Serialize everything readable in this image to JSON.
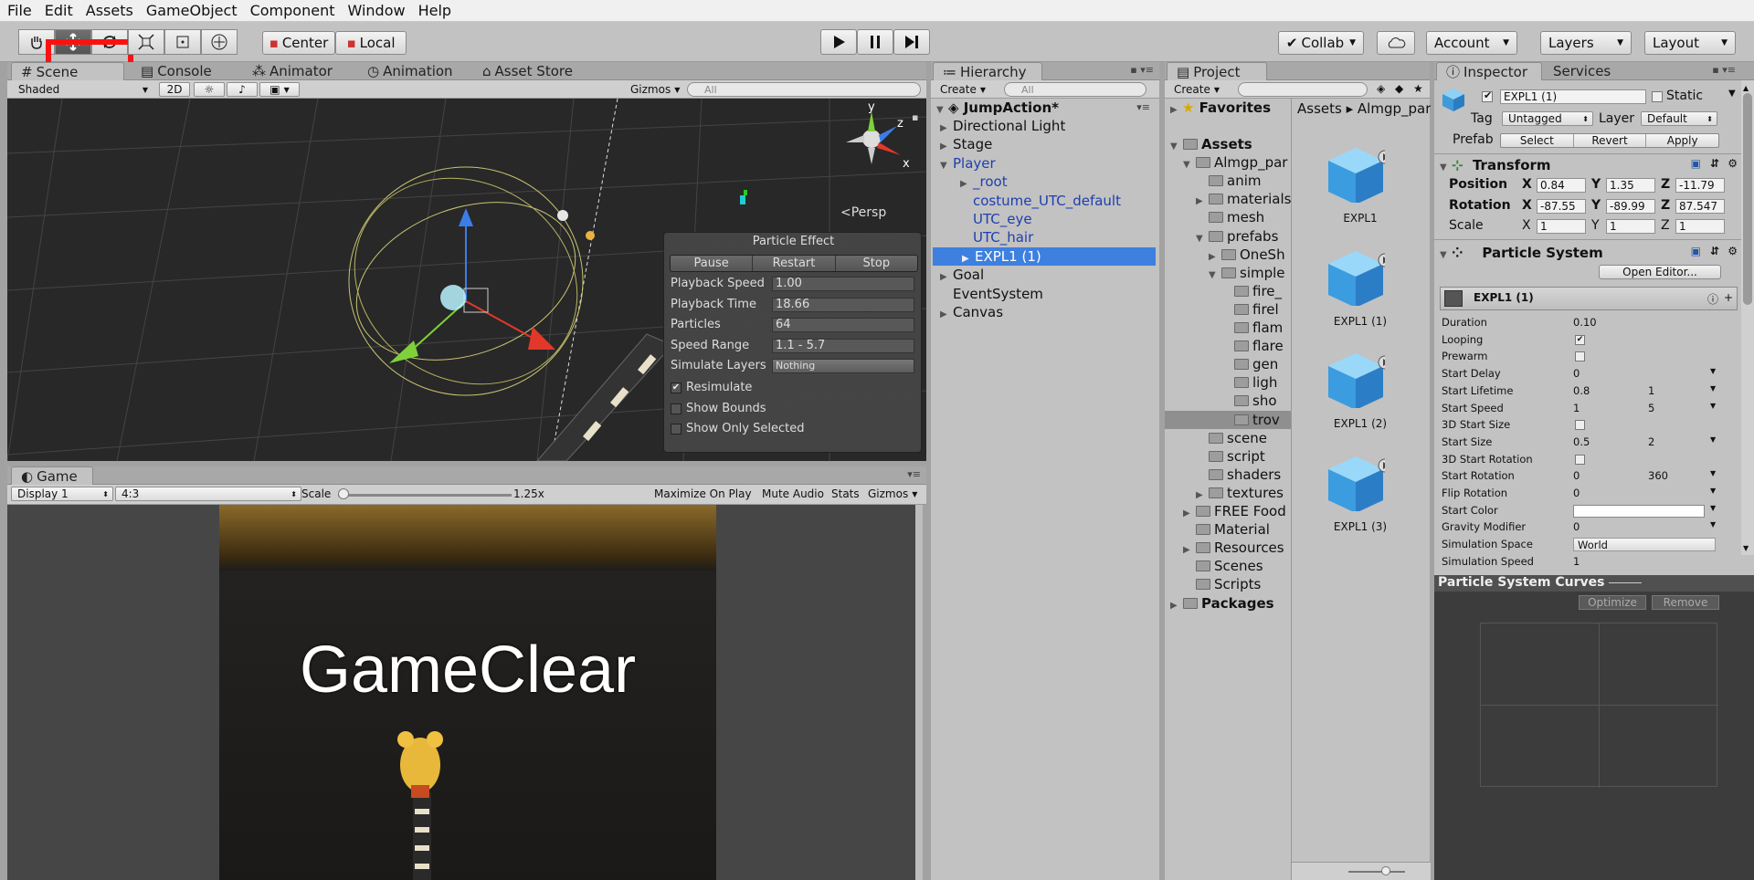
{
  "menu": [
    "File",
    "Edit",
    "Assets",
    "GameObject",
    "Component",
    "Window",
    "Help"
  ],
  "toolbar": {
    "center_label": "Center",
    "local_label": "Local",
    "collab_label": "Collab",
    "account_label": "Account",
    "layers_label": "Layers",
    "layout_label": "Layout"
  },
  "scene": {
    "tabs": [
      "Scene",
      "Console",
      "Animator",
      "Animation",
      "Asset Store"
    ],
    "shading": "Shaded",
    "mode_2d": "2D",
    "gizmos": "Gizmos",
    "search_placeholder": "All",
    "persp": "Persp",
    "gizmo_axes": {
      "y": "y",
      "z": "z",
      "x": "x"
    }
  },
  "particle_effect": {
    "title": "Particle Effect",
    "pause": "Pause",
    "restart": "Restart",
    "stop": "Stop",
    "rows": [
      {
        "label": "Playback Speed",
        "value": "1.00"
      },
      {
        "label": "Playback Time",
        "value": "18.66"
      },
      {
        "label": "Particles",
        "value": "64"
      },
      {
        "label": "Speed Range",
        "value": "1.1 - 5.7"
      },
      {
        "label": "Simulate Layers",
        "value": "Nothing"
      }
    ],
    "checks": [
      {
        "label": "Resimulate",
        "checked": true
      },
      {
        "label": "Show Bounds",
        "checked": false
      },
      {
        "label": "Show Only Selected",
        "checked": false
      }
    ]
  },
  "game": {
    "tab": "Game",
    "display": "Display 1",
    "aspect": "4:3",
    "scale_label": "Scale",
    "scale_value": "1.25x",
    "maximize": "Maximize On Play",
    "mute": "Mute Audio",
    "stats": "Stats",
    "gizmos": "Gizmos",
    "overlay_text": "GameClear"
  },
  "hierarchy": {
    "tab": "Hierarchy",
    "create": "Create",
    "search_placeholder": "All",
    "scene_name": "JumpAction*",
    "items": [
      {
        "label": "Directional Light",
        "indent": 1,
        "arrow": true,
        "blue": false,
        "selected": false
      },
      {
        "label": "Stage",
        "indent": 1,
        "arrow": true,
        "blue": false,
        "selected": false
      },
      {
        "label": "Player",
        "indent": 1,
        "arrow": true,
        "open": true,
        "blue": true,
        "selected": false
      },
      {
        "label": "_root",
        "indent": 2,
        "arrow": true,
        "blue": true,
        "selected": false
      },
      {
        "label": "costume_UTC_default",
        "indent": 2,
        "arrow": false,
        "blue": true,
        "selected": false
      },
      {
        "label": "UTC_eye",
        "indent": 2,
        "arrow": false,
        "blue": true,
        "selected": false
      },
      {
        "label": "UTC_hair",
        "indent": 2,
        "arrow": false,
        "blue": true,
        "selected": false
      },
      {
        "label": "EXPL1 (1)",
        "indent": 2,
        "arrow": true,
        "blue": true,
        "selected": true
      },
      {
        "label": "Goal",
        "indent": 1,
        "arrow": true,
        "blue": false,
        "selected": false
      },
      {
        "label": "EventSystem",
        "indent": 1,
        "arrow": false,
        "blue": false,
        "selected": false
      },
      {
        "label": "Canvas",
        "indent": 1,
        "arrow": true,
        "blue": false,
        "selected": false
      }
    ]
  },
  "project": {
    "tab": "Project",
    "create": "Create",
    "favorites": "Favorites",
    "breadcrumb": [
      "Assets",
      "Almgp_par"
    ],
    "tree": [
      {
        "label": "Assets",
        "indent": 0,
        "arrow": "open",
        "bold": true
      },
      {
        "label": "Almgp_par",
        "indent": 1,
        "arrow": "open"
      },
      {
        "label": "anim",
        "indent": 2,
        "arrow": ""
      },
      {
        "label": "materials",
        "indent": 2,
        "arrow": "closed"
      },
      {
        "label": "mesh",
        "indent": 2,
        "arrow": ""
      },
      {
        "label": "prefabs",
        "indent": 2,
        "arrow": "open"
      },
      {
        "label": "OneSh",
        "indent": 3,
        "arrow": "closed"
      },
      {
        "label": "simple",
        "indent": 3,
        "arrow": "open"
      },
      {
        "label": "fire_",
        "indent": 4,
        "arrow": ""
      },
      {
        "label": "firel",
        "indent": 4,
        "arrow": ""
      },
      {
        "label": "flam",
        "indent": 4,
        "arrow": ""
      },
      {
        "label": "flare",
        "indent": 4,
        "arrow": ""
      },
      {
        "label": "gen",
        "indent": 4,
        "arrow": ""
      },
      {
        "label": "ligh",
        "indent": 4,
        "arrow": ""
      },
      {
        "label": "sho",
        "indent": 4,
        "arrow": ""
      },
      {
        "label": "trov",
        "indent": 4,
        "arrow": "",
        "selected": true
      },
      {
        "label": "scene",
        "indent": 2,
        "arrow": ""
      },
      {
        "label": "script",
        "indent": 2,
        "arrow": ""
      },
      {
        "label": "shaders",
        "indent": 2,
        "arrow": ""
      },
      {
        "label": "textures",
        "indent": 2,
        "arrow": "closed"
      },
      {
        "label": "FREE Food",
        "indent": 1,
        "arrow": "closed"
      },
      {
        "label": "Material",
        "indent": 1,
        "arrow": ""
      },
      {
        "label": "Resources",
        "indent": 1,
        "arrow": "closed"
      },
      {
        "label": "Scenes",
        "indent": 1,
        "arrow": ""
      },
      {
        "label": "Scripts",
        "indent": 1,
        "arrow": ""
      },
      {
        "label": "Packages",
        "indent": 0,
        "arrow": "closed",
        "bold": true
      }
    ],
    "assets": [
      "EXPL1",
      "EXPL1 (1)",
      "EXPL1 (2)",
      "EXPL1 (3)"
    ]
  },
  "inspector": {
    "tab": "Inspector",
    "tab2": "Services",
    "object_name": "EXPL1 (1)",
    "static": "Static",
    "tag_label": "Tag",
    "tag": "Untagged",
    "layer_label": "Layer",
    "layer": "Default",
    "prefab_label": "Prefab",
    "select": "Select",
    "revert": "Revert",
    "apply": "Apply",
    "transform": {
      "title": "Transform",
      "position": {
        "label": "Position",
        "x": "0.84",
        "y": "1.35",
        "z": "-11.79"
      },
      "rotation": {
        "label": "Rotation",
        "x": "-87.55",
        "y": "-89.99",
        "z": "87.547"
      },
      "scale": {
        "label": "Scale",
        "x": "1",
        "y": "1",
        "z": "1"
      }
    },
    "particle_system": {
      "title": "Particle System",
      "open_editor": "Open Editor...",
      "module": "EXPL1 (1)",
      "rows": [
        {
          "label": "Duration",
          "value": "0.10"
        },
        {
          "label": "Looping",
          "check": true
        },
        {
          "label": "Prewarm",
          "check": false
        },
        {
          "label": "Start Delay",
          "value": "0"
        },
        {
          "label": "Start Lifetime",
          "value": "0.8",
          "value2": "1"
        },
        {
          "label": "Start Speed",
          "value": "1",
          "value2": "5"
        },
        {
          "label": "3D Start Size",
          "check": false
        },
        {
          "label": "Start Size",
          "value": "0.5",
          "value2": "2"
        },
        {
          "label": "3D Start Rotation",
          "check": false
        },
        {
          "label": "Start Rotation",
          "value": "0",
          "value2": "360"
        },
        {
          "label": "Flip Rotation",
          "value": "0"
        },
        {
          "label": "Start Color",
          "value": ""
        },
        {
          "label": "Gravity Modifier",
          "value": "0"
        },
        {
          "label": "Simulation Space",
          "value": "World"
        },
        {
          "label": "Simulation Speed",
          "value": "1"
        }
      ]
    },
    "curves": {
      "title": "Particle System Curves",
      "optimize": "Optimize",
      "remove": "Remove"
    }
  },
  "colors": {
    "highlight": "#ff1010",
    "selection": "#3d80df",
    "prefab_blue": "#1c3fb0"
  }
}
